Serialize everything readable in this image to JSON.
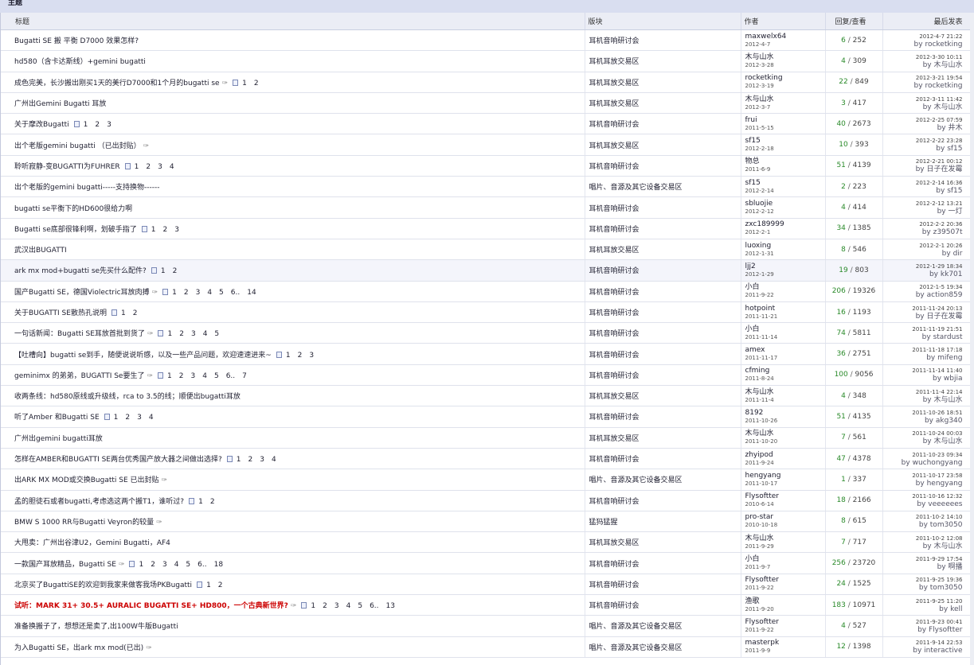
{
  "header": {
    "section_label": "主题"
  },
  "columns": {
    "title": "标题",
    "board": "版块",
    "author": "作者",
    "replies": "回复/查看",
    "last": "最后发表"
  },
  "by_prefix": "by",
  "threads": [
    {
      "title": "Bugatti SE 搬 平衡 D7000 效果怎样?",
      "attach": false,
      "pages": [],
      "board": "耳机音响研讨会",
      "author": "maxwelx64",
      "date": "2012-4-7",
      "replies": "6",
      "views": "252",
      "last_date": "2012-4-7 21:22",
      "last_by": "rocketking"
    },
    {
      "title": "hd580（含卡达斯线）+gemini bugatti",
      "attach": false,
      "pages": [],
      "board": "耳机耳放交易区",
      "author": "木与山水",
      "date": "2012-3-28",
      "replies": "4",
      "views": "309",
      "last_date": "2012-3-30 10:11",
      "last_by": "木与山水"
    },
    {
      "title": "成色完美，长沙搬出刚买1天的美行D7000和1个月的bugatti se",
      "attach": true,
      "pages": [
        "1",
        "2"
      ],
      "board": "耳机耳放交易区",
      "author": "rocketking",
      "date": "2012-3-19",
      "replies": "22",
      "views": "849",
      "last_date": "2012-3-21 19:54",
      "last_by": "rocketking"
    },
    {
      "title": "广州出Gemini Bugatti 耳放",
      "attach": false,
      "pages": [],
      "board": "耳机耳放交易区",
      "author": "木与山水",
      "date": "2012-3-7",
      "replies": "3",
      "views": "417",
      "last_date": "2012-3-11 11:42",
      "last_by": "木与山水"
    },
    {
      "title": "关于摩改Bugatti",
      "attach": false,
      "pages": [
        "1",
        "2",
        "3"
      ],
      "board": "耳机音响研讨会",
      "author": "frui",
      "date": "2011-5-15",
      "replies": "40",
      "views": "2673",
      "last_date": "2012-2-25 07:59",
      "last_by": "井木"
    },
    {
      "title": "出个老版gemini bugatti （已出封贴）",
      "attach": true,
      "pages": [],
      "board": "耳机耳放交易区",
      "author": "sf15",
      "date": "2012-2-18",
      "replies": "10",
      "views": "393",
      "last_date": "2012-2-22 23:28",
      "last_by": "sf15"
    },
    {
      "title": "聆听寂静-变BUGATTI为FUHRER",
      "attach": false,
      "pages": [
        "1",
        "2",
        "3",
        "4"
      ],
      "board": "耳机音响研讨会",
      "author": "物总",
      "date": "2011-6-9",
      "replies": "51",
      "views": "4139",
      "last_date": "2012-2-21 00:12",
      "last_by": "日子在发霉"
    },
    {
      "title": "出个老版的gemini bugatti-----支持换物------",
      "attach": false,
      "pages": [],
      "board": "唱片、音源及其它设备交易区",
      "author": "sf15",
      "date": "2012-2-14",
      "replies": "2",
      "views": "223",
      "last_date": "2012-2-14 16:36",
      "last_by": "sf15"
    },
    {
      "title": "bugatti se平衡下的HD600很给力啊",
      "attach": false,
      "pages": [],
      "board": "耳机音响研讨会",
      "author": "sbluojie",
      "date": "2012-2-12",
      "replies": "4",
      "views": "414",
      "last_date": "2012-2-12 13:21",
      "last_by": "一灯"
    },
    {
      "title": "Bugatti se底部很锋利啊，划破手指了",
      "attach": false,
      "pages": [
        "1",
        "2",
        "3"
      ],
      "board": "耳机音响研讨会",
      "author": "zxc189999",
      "date": "2012-2-1",
      "replies": "34",
      "views": "1385",
      "last_date": "2012-2-2 20:36",
      "last_by": "z39507t"
    },
    {
      "title": "武汉出BUGATTI",
      "attach": false,
      "pages": [],
      "board": "耳机耳放交易区",
      "author": "luoxing",
      "date": "2012-1-31",
      "replies": "8",
      "views": "546",
      "last_date": "2012-2-1 20:26",
      "last_by": "dir"
    },
    {
      "title": "ark mx mod+bugatti se先买什么配件?",
      "attach": false,
      "pages": [
        "1",
        "2"
      ],
      "board": "耳机音响研讨会",
      "author": "ljj2",
      "date": "2012-1-29",
      "replies": "19",
      "views": "803",
      "last_date": "2012-1-29 18:34",
      "last_by": "kk701"
    },
    {
      "title": "国产Bugatti SE，德国Violectric耳放肉搏",
      "attach": true,
      "pages": [
        "1",
        "2",
        "3",
        "4",
        "5",
        "6..",
        "14"
      ],
      "board": "耳机音响研讨会",
      "author": "小白",
      "date": "2011-9-22",
      "replies": "206",
      "views": "19326",
      "last_date": "2012-1-5 19:34",
      "last_by": "action859"
    },
    {
      "title": "关于BUGATTI SE散热孔说明",
      "attach": false,
      "pages": [
        "1",
        "2"
      ],
      "board": "耳机音响研讨会",
      "author": "hotpoint",
      "date": "2011-11-21",
      "replies": "16",
      "views": "1193",
      "last_date": "2011-11-24 20:13",
      "last_by": "日子在发霉"
    },
    {
      "title": "一句话新闻：Bugatti SE耳放首批到货了",
      "attach": true,
      "pages": [
        "1",
        "2",
        "3",
        "4",
        "5"
      ],
      "board": "耳机音响研讨会",
      "author": "小白",
      "date": "2011-11-14",
      "replies": "74",
      "views": "5811",
      "last_date": "2011-11-19 21:51",
      "last_by": "stardust"
    },
    {
      "title": "【吐槽向】bugatti se到手，随便说说听感，以及一些产品问题，欢迎速速进来~",
      "attach": false,
      "pages": [
        "1",
        "2",
        "3"
      ],
      "board": "耳机音响研讨会",
      "author": "amex",
      "date": "2011-11-17",
      "replies": "36",
      "views": "2751",
      "last_date": "2011-11-18 17:18",
      "last_by": "mifeng"
    },
    {
      "title": "geminimx 的弟弟，BUGATTI Se要生了",
      "attach": true,
      "pages": [
        "1",
        "2",
        "3",
        "4",
        "5",
        "6..",
        "7"
      ],
      "board": "耳机音响研讨会",
      "author": "cfming",
      "date": "2011-8-24",
      "replies": "100",
      "views": "9056",
      "last_date": "2011-11-14 11:40",
      "last_by": "wbjia"
    },
    {
      "title": "收两条线：hd580原线或升级线，rca to 3.5的线；顺便出bugatti耳放",
      "attach": false,
      "pages": [],
      "board": "耳机耳放交易区",
      "author": "木与山水",
      "date": "2011-11-4",
      "replies": "4",
      "views": "348",
      "last_date": "2011-11-4 22:14",
      "last_by": "木与山水"
    },
    {
      "title": "听了Amber 和Bugatti SE",
      "attach": false,
      "pages": [
        "1",
        "2",
        "3",
        "4"
      ],
      "board": "耳机音响研讨会",
      "author": "8192",
      "date": "2011-10-26",
      "replies": "51",
      "views": "4135",
      "last_date": "2011-10-26 18:51",
      "last_by": "akg340"
    },
    {
      "title": "广州出gemini bugatti耳放",
      "attach": false,
      "pages": [],
      "board": "耳机耳放交易区",
      "author": "木与山水",
      "date": "2011-10-20",
      "replies": "7",
      "views": "561",
      "last_date": "2011-10-24 00:03",
      "last_by": "木与山水"
    },
    {
      "title": "怎样在AMBER和BUGATTI SE两台优秀国产放大器之间做出选择?",
      "attach": false,
      "pages": [
        "1",
        "2",
        "3",
        "4"
      ],
      "board": "耳机音响研讨会",
      "author": "zhyipod",
      "date": "2011-9-24",
      "replies": "47",
      "views": "4378",
      "last_date": "2011-10-23 09:34",
      "last_by": "wuchongyang"
    },
    {
      "title": "出ARK MX MOD或交换Bugatti SE 已出封贴",
      "attach": true,
      "pages": [],
      "board": "唱片、音源及其它设备交易区",
      "author": "hengyang",
      "date": "2011-10-17",
      "replies": "1",
      "views": "337",
      "last_date": "2011-10-17 23:58",
      "last_by": "hengyang"
    },
    {
      "title": "孟的胆徒石或者bugatti,考虑选这两个搬T1，谁听过?",
      "attach": false,
      "pages": [
        "1",
        "2"
      ],
      "board": "耳机音响研讨会",
      "author": "Flysoftter",
      "date": "2010-6-14",
      "replies": "18",
      "views": "2166",
      "last_date": "2011-10-16 12:32",
      "last_by": "veeeeees"
    },
    {
      "title": "BMW S 1000 RR与Bugatti Veyron的较量",
      "attach": true,
      "pages": [],
      "board": "猛犸猛猩",
      "author": "pro-star",
      "date": "2010-10-18",
      "replies": "8",
      "views": "615",
      "last_date": "2011-10-2 14:10",
      "last_by": "tom3050"
    },
    {
      "title": "大甩卖：广州出谷津U2，Gemini Bugatti，AF4",
      "attach": false,
      "pages": [],
      "board": "耳机耳放交易区",
      "author": "木与山水",
      "date": "2011-9-29",
      "replies": "7",
      "views": "717",
      "last_date": "2011-10-2 12:08",
      "last_by": "木与山水"
    },
    {
      "title": "一款国产耳放精品，Bugatti SE",
      "attach": true,
      "pages": [
        "1",
        "2",
        "3",
        "4",
        "5",
        "6..",
        "18"
      ],
      "board": "耳机音响研讨会",
      "author": "小白",
      "date": "2011-9-7",
      "replies": "256",
      "views": "23720",
      "last_date": "2011-9-29 17:54",
      "last_by": "啊播"
    },
    {
      "title": "北京买了BugattiSE的欢迎到我家来做客我场PKBugatti",
      "attach": false,
      "pages": [
        "1",
        "2"
      ],
      "board": "耳机音响研讨会",
      "author": "Flysoftter",
      "date": "2011-9-22",
      "replies": "24",
      "views": "1525",
      "last_date": "2011-9-25 19:36",
      "last_by": "tom3050"
    },
    {
      "title": "试听：MARK 31+ 30.5+ AURALIC BUGATTI SE+ HD800，一个古典新世界?",
      "hot": true,
      "attach": true,
      "pages": [
        "1",
        "2",
        "3",
        "4",
        "5",
        "6..",
        "13"
      ],
      "board": "耳机音响研讨会",
      "author": "渔歌",
      "date": "2011-9-20",
      "replies": "183",
      "views": "10971",
      "last_date": "2011-9-25 11:20",
      "last_by": "kell"
    },
    {
      "title": "准备换搬子了，想想还是卖了,出100W牛版Bugatti",
      "attach": false,
      "pages": [],
      "board": "唱片、音源及其它设备交易区",
      "author": "Flysoftter",
      "date": "2011-9-22",
      "replies": "4",
      "views": "527",
      "last_date": "2011-9-23 00:41",
      "last_by": "Flysoftter"
    },
    {
      "title": "为入Bugatti SE，出ark mx mod(已出)",
      "attach": true,
      "pages": [],
      "board": "唱片、音源及其它设备交易区",
      "author": "masterpk",
      "date": "2011-9-9",
      "replies": "12",
      "views": "1398",
      "last_date": "2011-9-14 22:53",
      "last_by": "interactive"
    }
  ]
}
